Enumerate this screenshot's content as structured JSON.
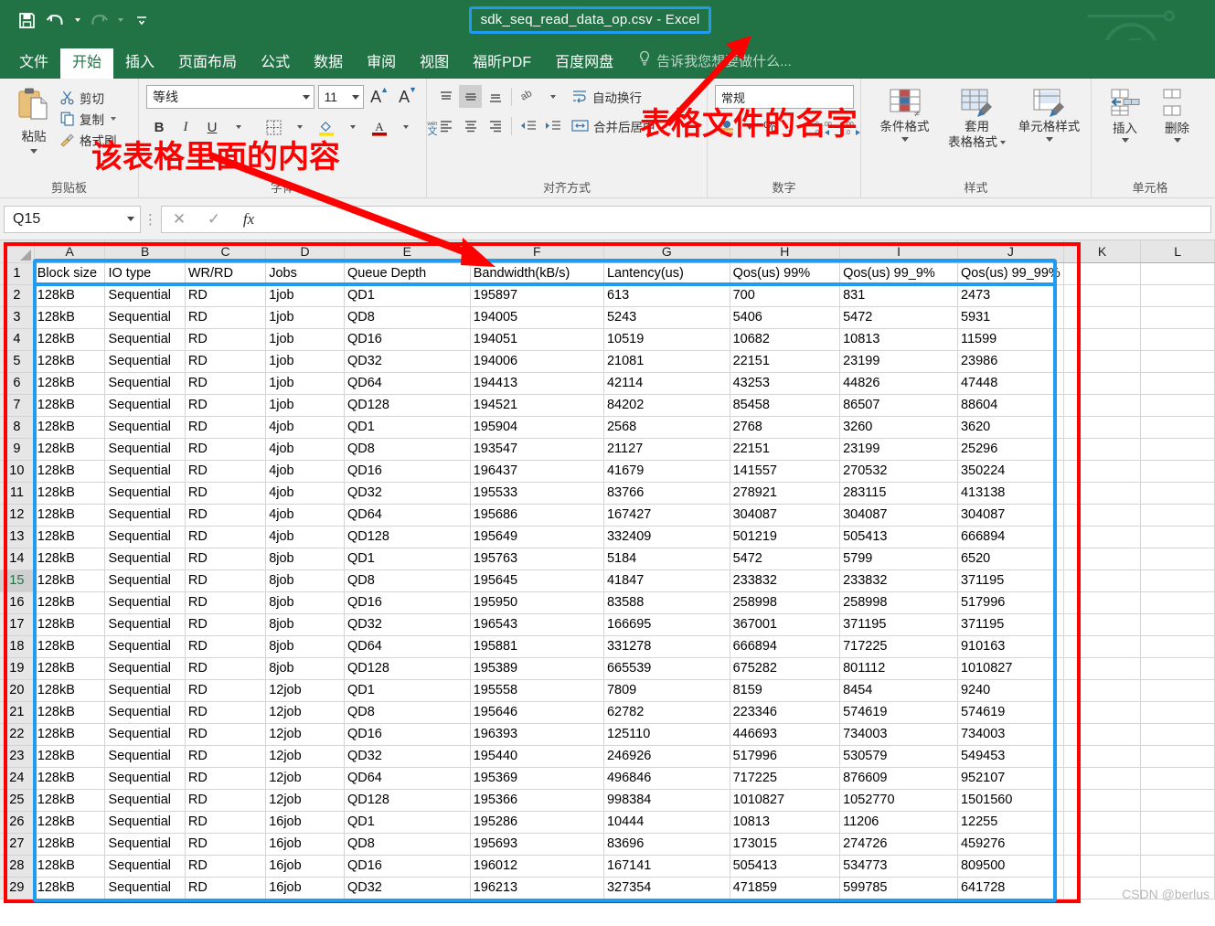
{
  "titlebar": {
    "document_title": "sdk_seq_read_data_op.csv - Excel",
    "quick_access": [
      {
        "name": "save",
        "icon": "save-icon"
      },
      {
        "name": "undo",
        "icon": "undo-icon"
      },
      {
        "name": "redo",
        "icon": "redo-icon"
      },
      {
        "name": "customize",
        "icon": "chevron-down-icon"
      }
    ]
  },
  "tabs": [
    {
      "label": "文件",
      "active": false
    },
    {
      "label": "开始",
      "active": true
    },
    {
      "label": "插入",
      "active": false
    },
    {
      "label": "页面布局",
      "active": false
    },
    {
      "label": "公式",
      "active": false
    },
    {
      "label": "数据",
      "active": false
    },
    {
      "label": "审阅",
      "active": false
    },
    {
      "label": "视图",
      "active": false
    },
    {
      "label": "福昕PDF",
      "active": false
    },
    {
      "label": "百度网盘",
      "active": false
    }
  ],
  "tellme": "告诉我您想要做什么...",
  "ribbon": {
    "clipboard": {
      "group_label": "剪贴板",
      "paste": "粘贴",
      "cut": "剪切",
      "copy": "复制",
      "format_painter": "格式刷"
    },
    "font": {
      "group_label": "字体",
      "font_name": "等线",
      "font_size": "11",
      "grow_font": "A",
      "shrink_font": "A",
      "bold": "B",
      "italic": "I",
      "underline": "U",
      "border": "田",
      "fill_color": "A",
      "font_color": "A",
      "phonetic": "wén"
    },
    "alignment": {
      "group_label": "对齐方式",
      "wrap_text": "自动换行",
      "merge_center": "合并后居中"
    },
    "number": {
      "group_label": "数字",
      "format": "常规",
      "percent": "%",
      "comma": ",",
      "increase_decimal": ".00",
      "decrease_decimal": ".0"
    },
    "styles": {
      "group_label": "样式",
      "conditional_formatting": "条件格式",
      "format_as_table_line1": "套用",
      "format_as_table_line2": "表格格式",
      "cell_styles": "单元格样式"
    },
    "cells": {
      "group_label": "单元格",
      "insert": "插入",
      "delete": "删除"
    }
  },
  "formula_bar": {
    "name_box": "Q15",
    "cancel": "✕",
    "confirm": "✓",
    "fx": "fx",
    "formula_value": ""
  },
  "annotations": {
    "content_note": "该表格里面的内容",
    "filename_note": "表格文件的名字",
    "accent_red": "#ff0000",
    "accent_blue": "#1f9bf0"
  },
  "watermark": "CSDN @berlus",
  "sheet": {
    "column_letters": [
      "A",
      "B",
      "C",
      "D",
      "E",
      "F",
      "G",
      "H",
      "I",
      "J",
      "K",
      "L"
    ],
    "headers": [
      "Block size",
      "IO type",
      "WR/RD",
      "Jobs",
      "Queue Depth",
      "Bandwidth(kB/s)",
      "Lantency(us)",
      "Qos(us) 99%",
      "Qos(us) 99_9%",
      "Qos(us) 99_99%"
    ],
    "active_row": 15,
    "rows": [
      [
        "128kB",
        "Sequential",
        "RD",
        "1job",
        "QD1",
        "195897",
        "613",
        "700",
        "831",
        "2473"
      ],
      [
        "128kB",
        "Sequential",
        "RD",
        "1job",
        "QD8",
        "194005",
        "5243",
        "5406",
        "5472",
        "5931"
      ],
      [
        "128kB",
        "Sequential",
        "RD",
        "1job",
        "QD16",
        "194051",
        "10519",
        "10682",
        "10813",
        "11599"
      ],
      [
        "128kB",
        "Sequential",
        "RD",
        "1job",
        "QD32",
        "194006",
        "21081",
        "22151",
        "23199",
        "23986"
      ],
      [
        "128kB",
        "Sequential",
        "RD",
        "1job",
        "QD64",
        "194413",
        "42114",
        "43253",
        "44826",
        "47448"
      ],
      [
        "128kB",
        "Sequential",
        "RD",
        "1job",
        "QD128",
        "194521",
        "84202",
        "85458",
        "86507",
        "88604"
      ],
      [
        "128kB",
        "Sequential",
        "RD",
        "4job",
        "QD1",
        "195904",
        "2568",
        "2768",
        "3260",
        "3620"
      ],
      [
        "128kB",
        "Sequential",
        "RD",
        "4job",
        "QD8",
        "193547",
        "21127",
        "22151",
        "23199",
        "25296"
      ],
      [
        "128kB",
        "Sequential",
        "RD",
        "4job",
        "QD16",
        "196437",
        "41679",
        "141557",
        "270532",
        "350224"
      ],
      [
        "128kB",
        "Sequential",
        "RD",
        "4job",
        "QD32",
        "195533",
        "83766",
        "278921",
        "283115",
        "413138"
      ],
      [
        "128kB",
        "Sequential",
        "RD",
        "4job",
        "QD64",
        "195686",
        "167427",
        "304087",
        "304087",
        "304087"
      ],
      [
        "128kB",
        "Sequential",
        "RD",
        "4job",
        "QD128",
        "195649",
        "332409",
        "501219",
        "505413",
        "666894"
      ],
      [
        "128kB",
        "Sequential",
        "RD",
        "8job",
        "QD1",
        "195763",
        "5184",
        "5472",
        "5799",
        "6520"
      ],
      [
        "128kB",
        "Sequential",
        "RD",
        "8job",
        "QD8",
        "195645",
        "41847",
        "233832",
        "233832",
        "371195"
      ],
      [
        "128kB",
        "Sequential",
        "RD",
        "8job",
        "QD16",
        "195950",
        "83588",
        "258998",
        "258998",
        "517996"
      ],
      [
        "128kB",
        "Sequential",
        "RD",
        "8job",
        "QD32",
        "196543",
        "166695",
        "367001",
        "371195",
        "371195"
      ],
      [
        "128kB",
        "Sequential",
        "RD",
        "8job",
        "QD64",
        "195881",
        "331278",
        "666894",
        "717225",
        "910163"
      ],
      [
        "128kB",
        "Sequential",
        "RD",
        "8job",
        "QD128",
        "195389",
        "665539",
        "675282",
        "801112",
        "1010827"
      ],
      [
        "128kB",
        "Sequential",
        "RD",
        "12job",
        "QD1",
        "195558",
        "7809",
        "8159",
        "8454",
        "9240"
      ],
      [
        "128kB",
        "Sequential",
        "RD",
        "12job",
        "QD8",
        "195646",
        "62782",
        "223346",
        "574619",
        "574619"
      ],
      [
        "128kB",
        "Sequential",
        "RD",
        "12job",
        "QD16",
        "196393",
        "125110",
        "446693",
        "734003",
        "734003"
      ],
      [
        "128kB",
        "Sequential",
        "RD",
        "12job",
        "QD32",
        "195440",
        "246926",
        "517996",
        "530579",
        "549453"
      ],
      [
        "128kB",
        "Sequential",
        "RD",
        "12job",
        "QD64",
        "195369",
        "496846",
        "717225",
        "876609",
        "952107"
      ],
      [
        "128kB",
        "Sequential",
        "RD",
        "12job",
        "QD128",
        "195366",
        "998384",
        "1010827",
        "1052770",
        "1501560"
      ],
      [
        "128kB",
        "Sequential",
        "RD",
        "16job",
        "QD1",
        "195286",
        "10444",
        "10813",
        "11206",
        "12255"
      ],
      [
        "128kB",
        "Sequential",
        "RD",
        "16job",
        "QD8",
        "195693",
        "83696",
        "173015",
        "274726",
        "459276"
      ],
      [
        "128kB",
        "Sequential",
        "RD",
        "16job",
        "QD16",
        "196012",
        "167141",
        "505413",
        "534773",
        "809500"
      ],
      [
        "128kB",
        "Sequential",
        "RD",
        "16job",
        "QD32",
        "196213",
        "327354",
        "471859",
        "599785",
        "641728"
      ]
    ]
  }
}
